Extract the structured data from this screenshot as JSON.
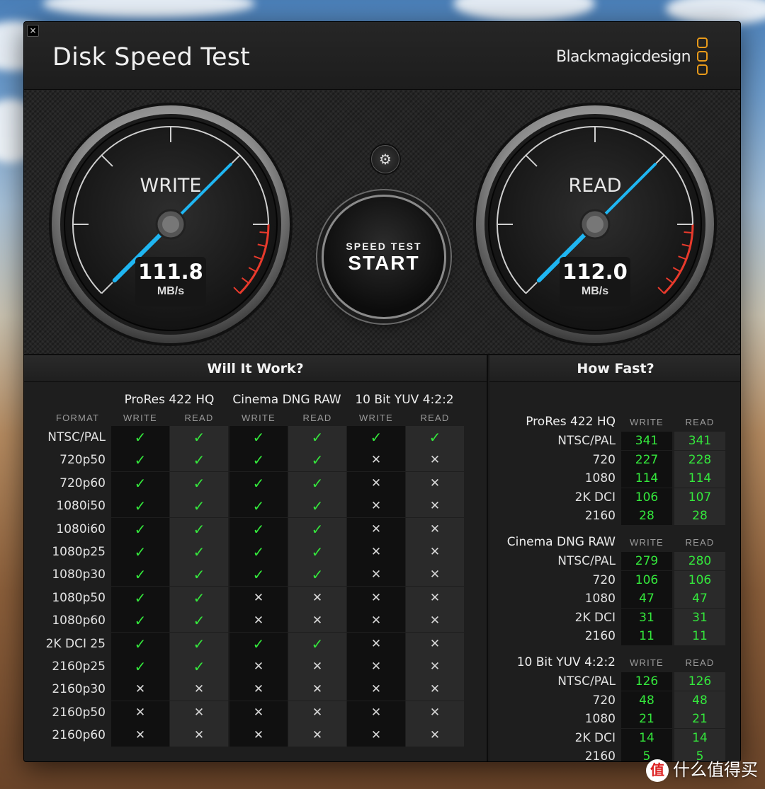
{
  "window": {
    "title": "Disk Speed Test",
    "brand": "Blackmagicdesign",
    "close_icon": "close-icon",
    "brand_color": "#e89a1a"
  },
  "gauges": {
    "write": {
      "label": "WRITE",
      "value": "111.8",
      "unit": "MB/s"
    },
    "read": {
      "label": "READ",
      "value": "112.0",
      "unit": "MB/s"
    },
    "needle_color": "#1fb6f2",
    "redzone_color": "#e83a2c"
  },
  "controls": {
    "settings_icon": "gear-icon",
    "start_sub": "SPEED TEST",
    "start_main": "START"
  },
  "will_it_work": {
    "title": "Will It Work?",
    "format_label": "FORMAT",
    "codecs": [
      "ProRes 422 HQ",
      "Cinema DNG RAW",
      "10 Bit YUV 4:2:2"
    ],
    "sub_labels": [
      "WRITE",
      "READ"
    ],
    "rows": [
      {
        "format": "NTSC/PAL",
        "results": [
          true,
          true,
          true,
          true,
          true,
          true
        ]
      },
      {
        "format": "720p50",
        "results": [
          true,
          true,
          true,
          true,
          false,
          false
        ]
      },
      {
        "format": "720p60",
        "results": [
          true,
          true,
          true,
          true,
          false,
          false
        ]
      },
      {
        "format": "1080i50",
        "results": [
          true,
          true,
          true,
          true,
          false,
          false
        ]
      },
      {
        "format": "1080i60",
        "results": [
          true,
          true,
          true,
          true,
          false,
          false
        ]
      },
      {
        "format": "1080p25",
        "results": [
          true,
          true,
          true,
          true,
          false,
          false
        ]
      },
      {
        "format": "1080p30",
        "results": [
          true,
          true,
          true,
          true,
          false,
          false
        ]
      },
      {
        "format": "1080p50",
        "results": [
          true,
          true,
          false,
          false,
          false,
          false
        ]
      },
      {
        "format": "1080p60",
        "results": [
          true,
          true,
          false,
          false,
          false,
          false
        ]
      },
      {
        "format": "2K DCI 25",
        "results": [
          true,
          true,
          true,
          true,
          false,
          false
        ]
      },
      {
        "format": "2160p25",
        "results": [
          true,
          true,
          false,
          false,
          false,
          false
        ]
      },
      {
        "format": "2160p30",
        "results": [
          false,
          false,
          false,
          false,
          false,
          false
        ]
      },
      {
        "format": "2160p50",
        "results": [
          false,
          false,
          false,
          false,
          false,
          false
        ]
      },
      {
        "format": "2160p60",
        "results": [
          false,
          false,
          false,
          false,
          false,
          false
        ]
      }
    ],
    "yes_glyph": "✓",
    "no_glyph": "✕"
  },
  "how_fast": {
    "title": "How Fast?",
    "groups": [
      {
        "codec": "ProRes 422 HQ",
        "write_label": "WRITE",
        "read_label": "READ",
        "rows": [
          {
            "format": "NTSC/PAL",
            "write": "341",
            "read": "341"
          },
          {
            "format": "720",
            "write": "227",
            "read": "228"
          },
          {
            "format": "1080",
            "write": "114",
            "read": "114"
          },
          {
            "format": "2K DCI",
            "write": "106",
            "read": "107"
          },
          {
            "format": "2160",
            "write": "28",
            "read": "28"
          }
        ]
      },
      {
        "codec": "Cinema DNG RAW",
        "write_label": "WRITE",
        "read_label": "READ",
        "rows": [
          {
            "format": "NTSC/PAL",
            "write": "279",
            "read": "280"
          },
          {
            "format": "720",
            "write": "106",
            "read": "106"
          },
          {
            "format": "1080",
            "write": "47",
            "read": "47"
          },
          {
            "format": "2K DCI",
            "write": "31",
            "read": "31"
          },
          {
            "format": "2160",
            "write": "11",
            "read": "11"
          }
        ]
      },
      {
        "codec": "10 Bit YUV 4:2:2",
        "write_label": "WRITE",
        "read_label": "READ",
        "rows": [
          {
            "format": "NTSC/PAL",
            "write": "126",
            "read": "126"
          },
          {
            "format": "720",
            "write": "48",
            "read": "48"
          },
          {
            "format": "1080",
            "write": "21",
            "read": "21"
          },
          {
            "format": "2K DCI",
            "write": "14",
            "read": "14"
          },
          {
            "format": "2160",
            "write": "5",
            "read": "5"
          }
        ]
      }
    ]
  },
  "watermark": {
    "icon_text": "值",
    "text": "什么值得买"
  }
}
